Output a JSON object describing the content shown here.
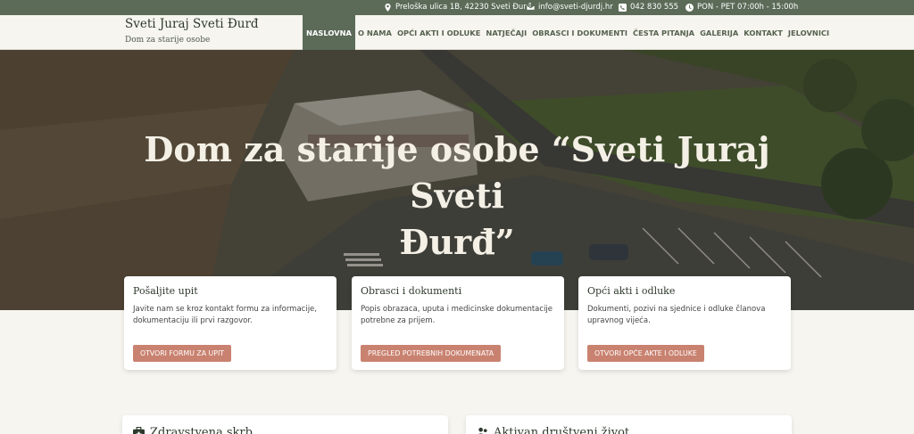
{
  "topbar": {
    "address": "Preloška ulica 1B, 42230 Sveti Đurđ",
    "email": "info@sveti-djurdj.hr",
    "phone": "042 830 555",
    "hours": "PON - PET 07:00h - 15:00h"
  },
  "header": {
    "title": "Sveti Juraj Sveti Đurđ",
    "subtitle": "Dom za starije osobe"
  },
  "nav": {
    "items": [
      "NASLOVNA",
      "O NAMA",
      "OPĆI AKTI I ODLUKE",
      "NATJEČAJI",
      "OBRASCI I DOKUMENTI",
      "ČESTA PITANJA",
      "GALERIJA",
      "KONTAKT",
      "JELOVNICI"
    ],
    "active": "NASLOVNA"
  },
  "hero": {
    "title_line1": "Dom za starije osobe “Sveti Juraj Sveti",
    "title_line2": "Đurđ”"
  },
  "cards": [
    {
      "title": "Pošaljite upit",
      "text": "Javite nam se kroz kontakt formu za informacije, dokumentaciju ili prvi razgovor.",
      "button": "OTVORI FORMU ZA UPIT"
    },
    {
      "title": "Obrasci i dokumenti",
      "text": "Popis obrazaca, uputa i medicinske dokumentacije potrebne za prijem.",
      "button": "PREGLED POTREBNIH DOKUMENATA"
    },
    {
      "title": "Opći akti i odluke",
      "text": "Dokumenti, pozivi na sjednice i odluke članova upravnog vijeća.",
      "button": "OTVORI OPĆE AKTE I ODLUKE"
    }
  ],
  "bottom": {
    "left_title": "Zdravstvena skrb",
    "right_title": "Aktivan društveni život"
  },
  "colors": {
    "accent": "#5b6b58",
    "button": "#c98270",
    "background": "#f7f5f0"
  }
}
